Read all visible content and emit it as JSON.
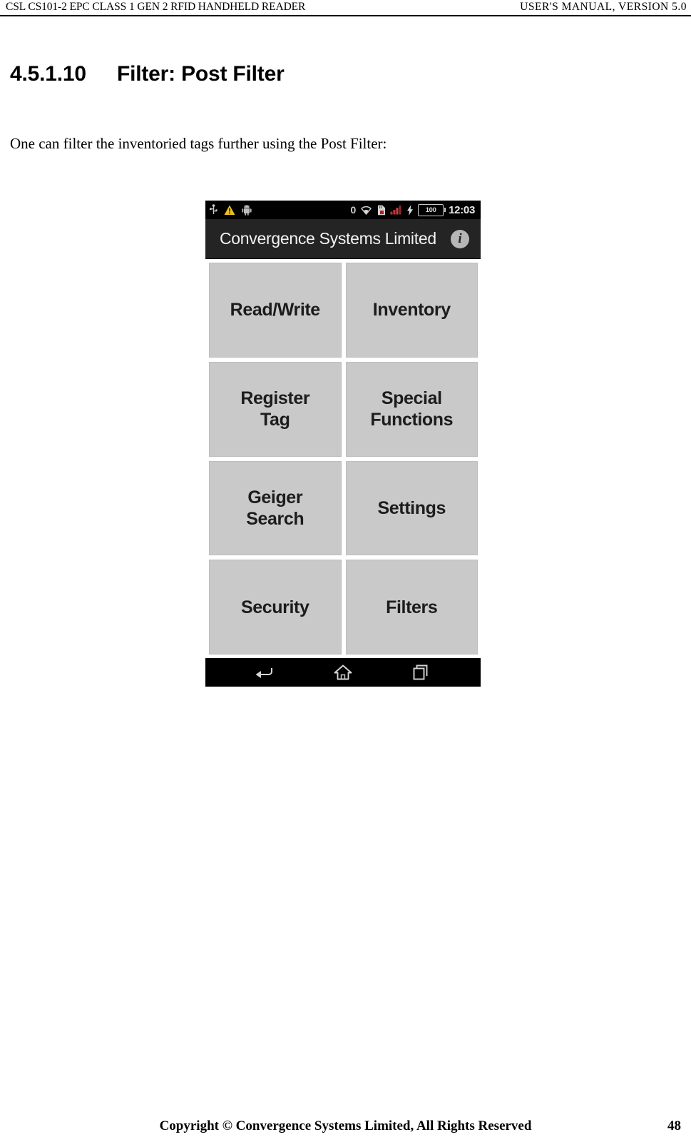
{
  "header": {
    "left": "CSL CS101-2 EPC CLASS 1 GEN 2 RFID HANDHELD READER",
    "right": "USER'S  MANUAL,  VERSION  5.0"
  },
  "section": {
    "number": "4.5.1.10",
    "title": "Filter: Post Filter"
  },
  "paragraph": "One can filter the inventoried tags further using the Post Filter:",
  "phone": {
    "status_bar": {
      "icons_left": [
        "usb-icon",
        "warning-triangle-icon",
        "android-robot-icon"
      ],
      "notification_count": "0",
      "icons_right": [
        "wifi-icon",
        "sdcard-icon",
        "signal-bars-icon",
        "charging-bolt-icon"
      ],
      "battery_level": "100",
      "clock": "12:03"
    },
    "action_bar": {
      "title": "Convergence Systems Limited",
      "info_glyph": "i",
      "info_icon": "info-icon"
    },
    "menu_buttons": [
      {
        "label": "Read/Write",
        "name": "read-write"
      },
      {
        "label": "Inventory",
        "name": "inventory"
      },
      {
        "label": "Register\nTag",
        "name": "register-tag"
      },
      {
        "label": "Special\nFunctions",
        "name": "special-functions"
      },
      {
        "label": "Geiger\nSearch",
        "name": "geiger-search"
      },
      {
        "label": "Settings",
        "name": "settings"
      },
      {
        "label": "Security",
        "name": "security"
      },
      {
        "label": "Filters",
        "name": "filters"
      }
    ],
    "nav_bar": [
      "back-icon",
      "home-icon",
      "recent-apps-icon"
    ]
  },
  "footer": {
    "copyright": "Copyright © Convergence Systems Limited, All Rights Reserved",
    "page_number": "48"
  },
  "colors": {
    "page_background": "#ffffff",
    "text": "#000000",
    "phone_chrome": "#000000",
    "action_bar": "#242424",
    "button_fill": "#c9c9c9",
    "button_border": "#bdbdbd",
    "warning_yellow": "#e8c020",
    "signal_red": "#c03030"
  }
}
